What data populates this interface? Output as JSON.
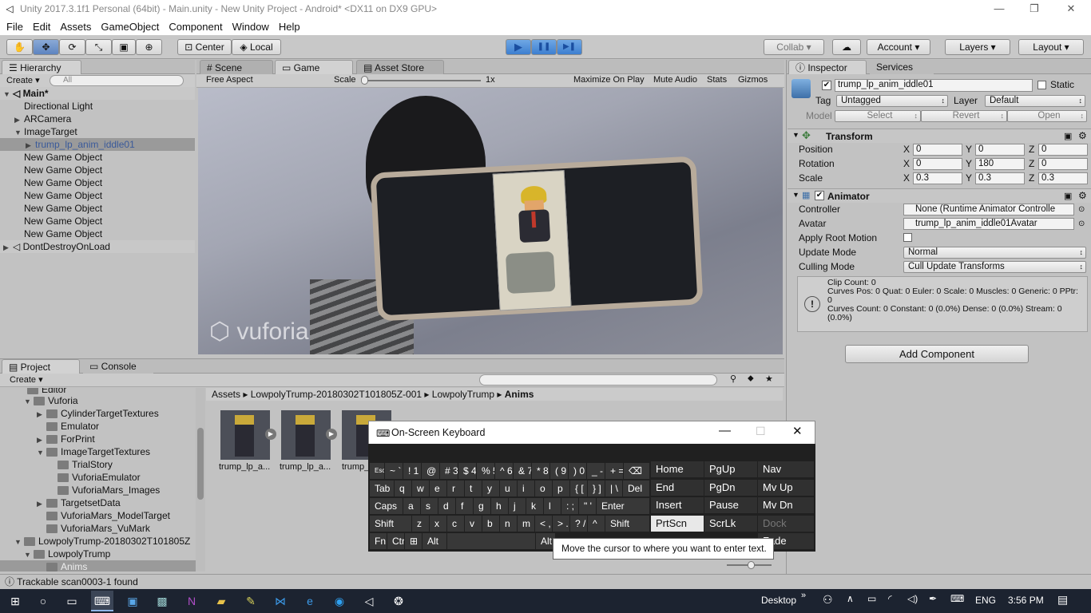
{
  "window": {
    "title": "Unity 2017.3.1f1 Personal (64bit) - Main.unity - New Unity Project - Android* <DX11 on DX9 GPU>",
    "minimize": "—",
    "restore": "❐",
    "close": "✕"
  },
  "menu": [
    "File",
    "Edit",
    "Assets",
    "GameObject",
    "Component",
    "Window",
    "Help"
  ],
  "toolbar": {
    "center": "Center",
    "local": "Local",
    "collab": "Collab ▾",
    "account": "Account",
    "layers": "Layers",
    "layout": "Layout",
    "play": "▶",
    "pause": "❚❚",
    "step": "▶❚"
  },
  "hierarchy": {
    "tab": "Hierarchy",
    "create": "Create ▾",
    "search_placeholder": "All",
    "scene": "Main*",
    "items": [
      "Directional Light",
      "ARCamera",
      "ImageTarget",
      "trump_lp_anim_iddle01",
      "New Game Object",
      "New Game Object",
      "New Game Object",
      "New Game Object",
      "New Game Object",
      "New Game Object",
      "New Game Object",
      "DontDestroyOnLoad"
    ]
  },
  "view": {
    "tabs": [
      "Scene",
      "Game",
      "Asset Store"
    ],
    "aspect": "Free Aspect",
    "scale_label": "Scale",
    "scale_value": "1x",
    "maximize": "Maximize On Play",
    "mute": "Mute Audio",
    "stats": "Stats",
    "gizmos": "Gizmos",
    "watermark": "vuforia"
  },
  "project": {
    "tabs": [
      "Project",
      "Console"
    ],
    "create": "Create ▾",
    "breadcrumb": [
      "Assets",
      "LowpolyTrump-20180302T101805Z-001",
      "LowpolyTrump",
      "Anims"
    ],
    "tree": [
      "Editor",
      "Vuforia",
      "CylinderTargetTextures",
      "Emulator",
      "ForPrint",
      "ImageTargetTextures",
      "TrialStory",
      "VuforiaEmulator",
      "VuforiaMars_Images",
      "TargetsetData",
      "VuforiaMars_ModelTarget",
      "VuforiaMars_VuMark",
      "LowpolyTrump-20180302T101805Z",
      "LowpolyTrump",
      "Anims"
    ],
    "assets": [
      "trump_lp_a...",
      "trump_lp_a...",
      "trump_"
    ]
  },
  "inspector": {
    "tabs": [
      "Inspector",
      "Services"
    ],
    "object_name": "trump_lp_anim_iddle01",
    "static": "Static",
    "tag_label": "Tag",
    "tag": "Untagged",
    "layer_label": "Layer",
    "layer": "Default",
    "model_label": "Model",
    "select": "Select",
    "revert": "Revert",
    "open": "Open",
    "transform": {
      "title": "Transform",
      "position": "Position",
      "rotation": "Rotation",
      "scale": "Scale",
      "pos": [
        "0",
        "0",
        "0"
      ],
      "rot": [
        "0",
        "180",
        "0"
      ],
      "scl": [
        "0.3",
        "0.3",
        "0.3"
      ],
      "x": "X",
      "y": "Y",
      "z": "Z"
    },
    "animator": {
      "title": "Animator",
      "controller_label": "Controller",
      "controller": "None (Runtime Animator Controlle",
      "avatar_label": "Avatar",
      "avatar": "trump_lp_anim_iddle01Avatar",
      "apply_root": "Apply Root Motion",
      "update_label": "Update Mode",
      "update": "Normal",
      "culling_label": "Culling Mode",
      "culling": "Cull Update Transforms",
      "info": "Clip Count: 0\nCurves Pos: 0 Quat: 0 Euler: 0 Scale: 0 Muscles: 0 Generic: 0 PPtr: 0\nCurves Count: 0 Constant: 0 (0.0%) Dense: 0 (0.0%) Stream: 0 (0.0%)"
    },
    "add_component": "Add Component"
  },
  "status": {
    "message": "Trackable scan0003-1 found"
  },
  "keyboard": {
    "title": "On-Screen Keyboard",
    "tooltip": "Move the cursor to where you want to enter text.",
    "row1": [
      "~ `",
      "! 1",
      "@ 2",
      "# 3",
      "$ 4",
      "% 5",
      "^ 6",
      "& 7",
      "* 8",
      "( 9",
      ") 0",
      "_ -",
      "+ =",
      "⌫"
    ],
    "row2": [
      "Tab",
      "q",
      "w",
      "e",
      "r",
      "t",
      "y",
      "u",
      "i",
      "o",
      "p",
      "{ [",
      "} ]",
      "| \\",
      "Del"
    ],
    "row3": [
      "Caps",
      "a",
      "s",
      "d",
      "f",
      "g",
      "h",
      "j",
      "k",
      "l",
      ": ;",
      "\" '",
      "Enter"
    ],
    "row4": [
      "Shift",
      "z",
      "x",
      "c",
      "v",
      "b",
      "n",
      "m",
      "< ,",
      "> .",
      "? /",
      "^",
      "Shift"
    ],
    "row5": [
      "Fn",
      "Ctrl",
      "⊞",
      "Alt",
      "",
      "Alt"
    ],
    "nav": [
      "Home",
      "PgUp",
      "Nav",
      "End",
      "PgDn",
      "Mv Up",
      "Insert",
      "Pause",
      "Mv Dn",
      "PrtScn",
      "ScrLk",
      "Dock",
      "",
      "",
      "Fade"
    ]
  },
  "taskbar": {
    "desktop": "Desktop",
    "lang": "ENG",
    "time": "3:56 PM"
  }
}
